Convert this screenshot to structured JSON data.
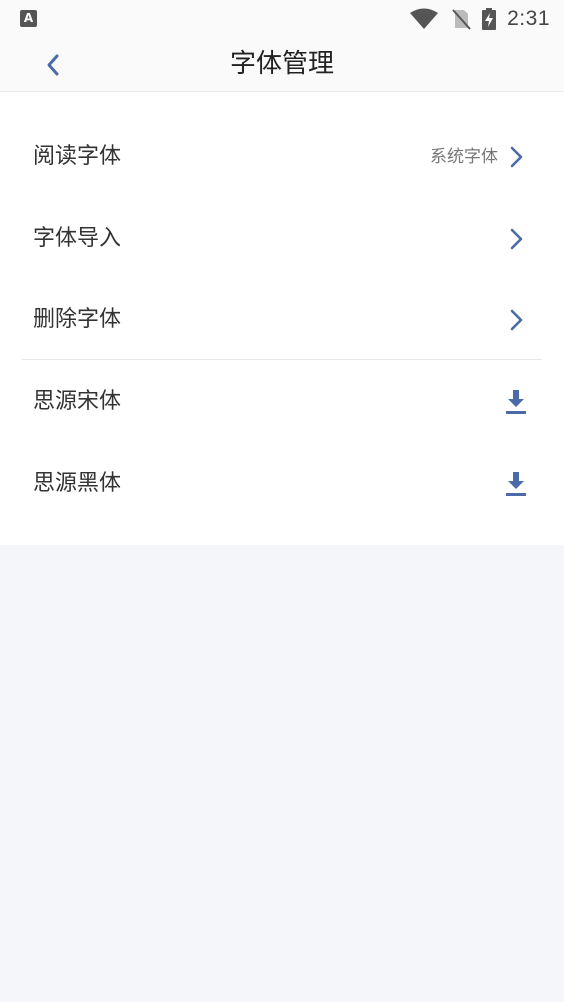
{
  "status": {
    "time": "2:31",
    "app_icon_letter": "A"
  },
  "header": {
    "title": "字体管理",
    "back_icon": "chevron-left-icon"
  },
  "settings_items": [
    {
      "label": "阅读字体",
      "value": "系统字体",
      "icon": "chevron-right-icon"
    },
    {
      "label": "字体导入",
      "value": "",
      "icon": "chevron-right-icon"
    },
    {
      "label": "删除字体",
      "value": "",
      "icon": "chevron-right-icon"
    }
  ],
  "font_items": [
    {
      "label": "思源宋体",
      "icon": "download-icon"
    },
    {
      "label": "思源黑体",
      "icon": "download-icon"
    }
  ],
  "colors": {
    "accent": "#4a6ba8",
    "background": "#f5f6fa",
    "panel": "#ffffff"
  }
}
